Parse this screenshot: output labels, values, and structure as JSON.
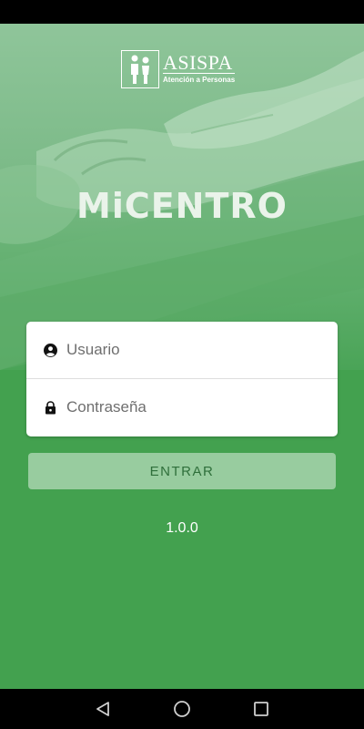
{
  "brand": {
    "logo_name": "ASISPA",
    "logo_tagline": "Atención a Personas",
    "app_title": "MiCENTRO"
  },
  "login": {
    "username_placeholder": "Usuario",
    "password_placeholder": "Contraseña",
    "submit_label": "ENTRAR"
  },
  "version": "1.0.0",
  "icons": {
    "username": "user-icon",
    "password": "lock-icon",
    "nav_back": "back-icon",
    "nav_home": "home-icon",
    "nav_recents": "recents-icon"
  },
  "colors": {
    "background": "#43a14f",
    "button": "#98cc9f",
    "button_text": "#2f6f3b"
  }
}
